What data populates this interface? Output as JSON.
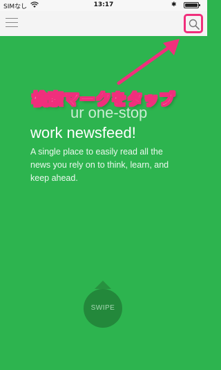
{
  "status_bar": {
    "carrier": "SIMなし",
    "time": "13:17",
    "bluetooth": "✱"
  },
  "nav": {
    "menu_icon": "hamburger-menu-icon",
    "search_icon": "search-icon"
  },
  "annotation": {
    "label": "検索マークをタップ",
    "color": "#f02f7c"
  },
  "hero": {
    "headline_partial": "ur one-stop",
    "headline": "work newsfeed!",
    "description": "A single place to easily read all the news you rely on to think, learn, and keep ahead."
  },
  "swipe": {
    "label": "SWIPE"
  },
  "colors": {
    "background": "#2db44f",
    "nav_background": "#f4f4f4",
    "swipe_button": "#23883b"
  }
}
